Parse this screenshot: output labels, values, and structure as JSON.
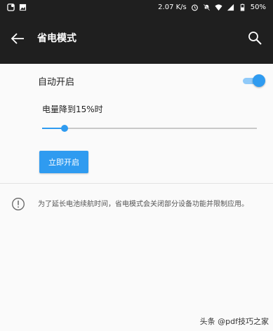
{
  "status_bar": {
    "speed": "2.07 K/s",
    "battery": "50%"
  },
  "app_bar": {
    "title": "省电模式"
  },
  "auto_enable": {
    "label": "自动开启",
    "on": true
  },
  "threshold": {
    "label": "电量降到15%时",
    "value_percent": 15
  },
  "enable_button": {
    "label": "立即开启"
  },
  "info": {
    "text": "为了延长电池续航时间，省电模式会关闭部分设备功能并限制应用。"
  },
  "watermark": {
    "text": "头条 @pdf技巧之家"
  },
  "colors": {
    "accent": "#2f9bf0",
    "app_bar": "#1f1f1f"
  }
}
